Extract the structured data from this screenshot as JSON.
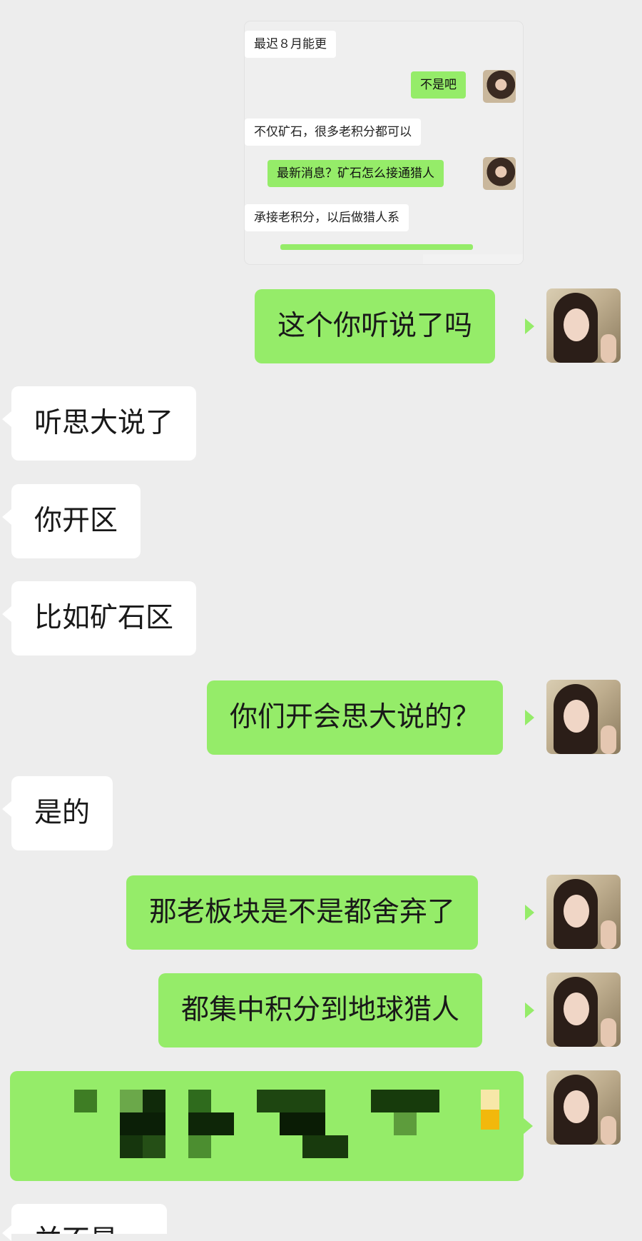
{
  "embedded_screenshot": {
    "messages": [
      {
        "side": "recv",
        "text": "最迟８月能更"
      },
      {
        "side": "sent",
        "text": "不是吧"
      },
      {
        "side": "recv",
        "text": "不仅矿石，很多老积分都可以"
      },
      {
        "side": "sent",
        "text": "最新消息？矿石怎么接通猎人"
      },
      {
        "side": "recv",
        "text": "承接老积分，以后做猎人系"
      }
    ]
  },
  "chat": {
    "messages": [
      {
        "side": "sent",
        "text": "这个你听说了吗"
      },
      {
        "side": "recv",
        "text": "听思大说了"
      },
      {
        "side": "recv",
        "text": "你开区"
      },
      {
        "side": "recv",
        "text": "比如矿石区"
      },
      {
        "side": "sent",
        "text": "你们开会思大说的？"
      },
      {
        "side": "recv",
        "text": "是的"
      },
      {
        "side": "sent",
        "text": "那老板块是不是都舍弃了"
      },
      {
        "side": "sent",
        "text": "都集中积分到地球猎人"
      },
      {
        "side": "recv",
        "text": "并不是..."
      }
    ]
  },
  "colors": {
    "sent_bubble": "#95ec69",
    "recv_bubble": "#ffffff",
    "background": "#ededed"
  }
}
